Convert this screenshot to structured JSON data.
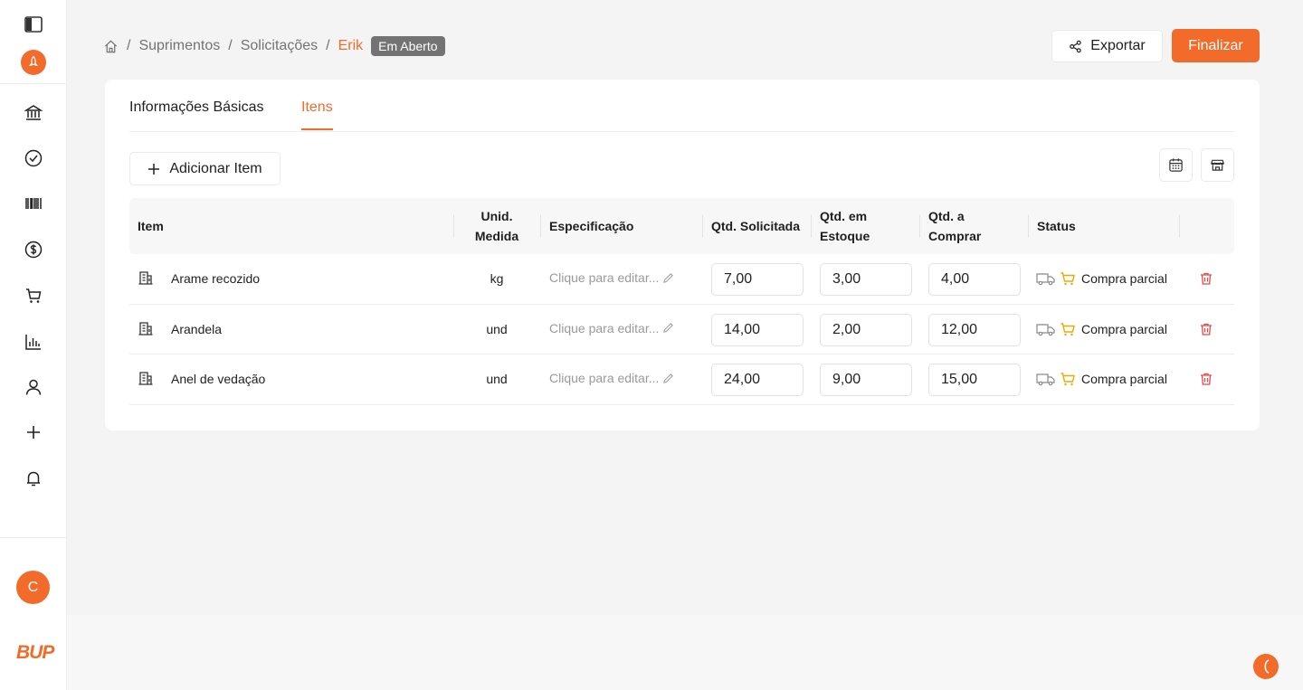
{
  "breadcrumb": {
    "items": [
      "Suprimentos",
      "Solicitações"
    ],
    "current": "Erik",
    "status_badge": "Em Aberto"
  },
  "actions": {
    "export_label": "Exportar",
    "finish_label": "Finalizar"
  },
  "tabs": [
    {
      "label": "Informações Básicas"
    },
    {
      "label": "Itens"
    }
  ],
  "toolbar": {
    "add_item_label": "Adicionar Item"
  },
  "table": {
    "headers": {
      "item": "Item",
      "unit_line1": "Unid.",
      "unit_line2": "Medida",
      "spec": "Especificação",
      "requested": "Qtd. Solicitada",
      "stock_line1": "Qtd. em",
      "stock_line2": "Estoque",
      "buy_line1": "Qtd. a",
      "buy_line2": "Comprar",
      "status": "Status"
    },
    "rows": [
      {
        "name": "Arame recozido",
        "unit": "kg",
        "spec": "Clique para editar...",
        "requested": "7,00",
        "stock": "3,00",
        "buy": "4,00",
        "status": "Compra parcial"
      },
      {
        "name": "Arandela",
        "unit": "und",
        "spec": "Clique para editar...",
        "requested": "14,00",
        "stock": "2,00",
        "buy": "12,00",
        "status": "Compra parcial"
      },
      {
        "name": "Anel de vedação",
        "unit": "und",
        "spec": "Clique para editar...",
        "requested": "24,00",
        "stock": "9,00",
        "buy": "15,00",
        "status": "Compra parcial"
      }
    ]
  },
  "user": {
    "avatar_initial": "C"
  },
  "brand": {
    "logo_text": "BUP",
    "accent_color": "#f26b2a"
  }
}
